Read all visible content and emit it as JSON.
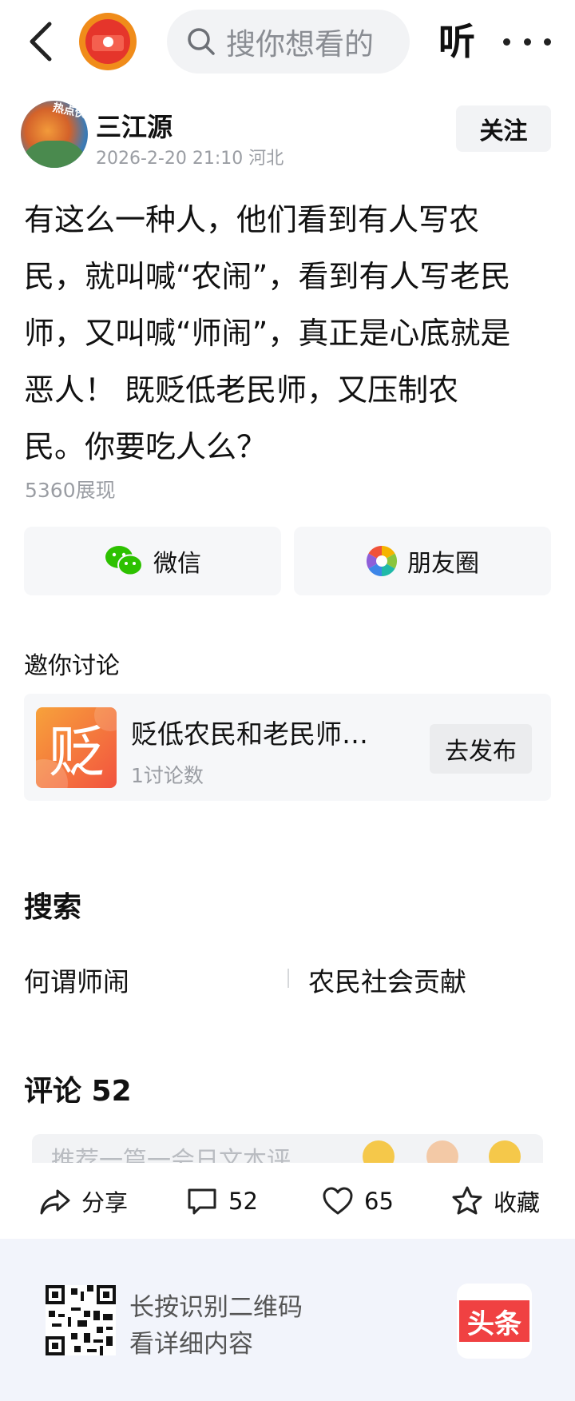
{
  "header": {
    "search_placeholder": "搜你想看的",
    "listen_label": "听"
  },
  "author": {
    "name": "三江源",
    "meta": "2026-2-20 21:10  河北",
    "avatar_tag": "热点侠",
    "follow_label": "关注"
  },
  "article": {
    "lines": [
      "有这么一种人，他们看到有人写农",
      "民，就叫喊“农闹”，看到有人写老民",
      "师，又叫喊“师闹”，真正是心底就是",
      "恶人！  既贬低老民师，又压制农",
      "民。你要吃人么？"
    ],
    "views": "5360展现"
  },
  "share": {
    "wechat_label": "微信",
    "moments_label": "朋友圈"
  },
  "discussion": {
    "heading": "邀你讨论",
    "thumb_char": "贬",
    "topic_title": "贬低农民和老民师…",
    "topic_count": "1讨论数",
    "publish_label": "去发布"
  },
  "search_section": {
    "heading": "搜索",
    "items": [
      "何谓师闹",
      "农民社会贡献"
    ]
  },
  "comments": {
    "heading": "评论 52",
    "input_placeholder": "推荐一篇一会日文本评"
  },
  "actions": {
    "share_label": "分享",
    "comment_count": "52",
    "like_count": "65",
    "collect_label": "收藏"
  },
  "footer": {
    "qr_line1": "长按识别二维码",
    "qr_line2": "看详细内容",
    "brand": "头条"
  },
  "colors": {
    "brand_red": "#f04142",
    "wechat_green": "#2dc100",
    "logo_orange": "#f08c1a"
  }
}
